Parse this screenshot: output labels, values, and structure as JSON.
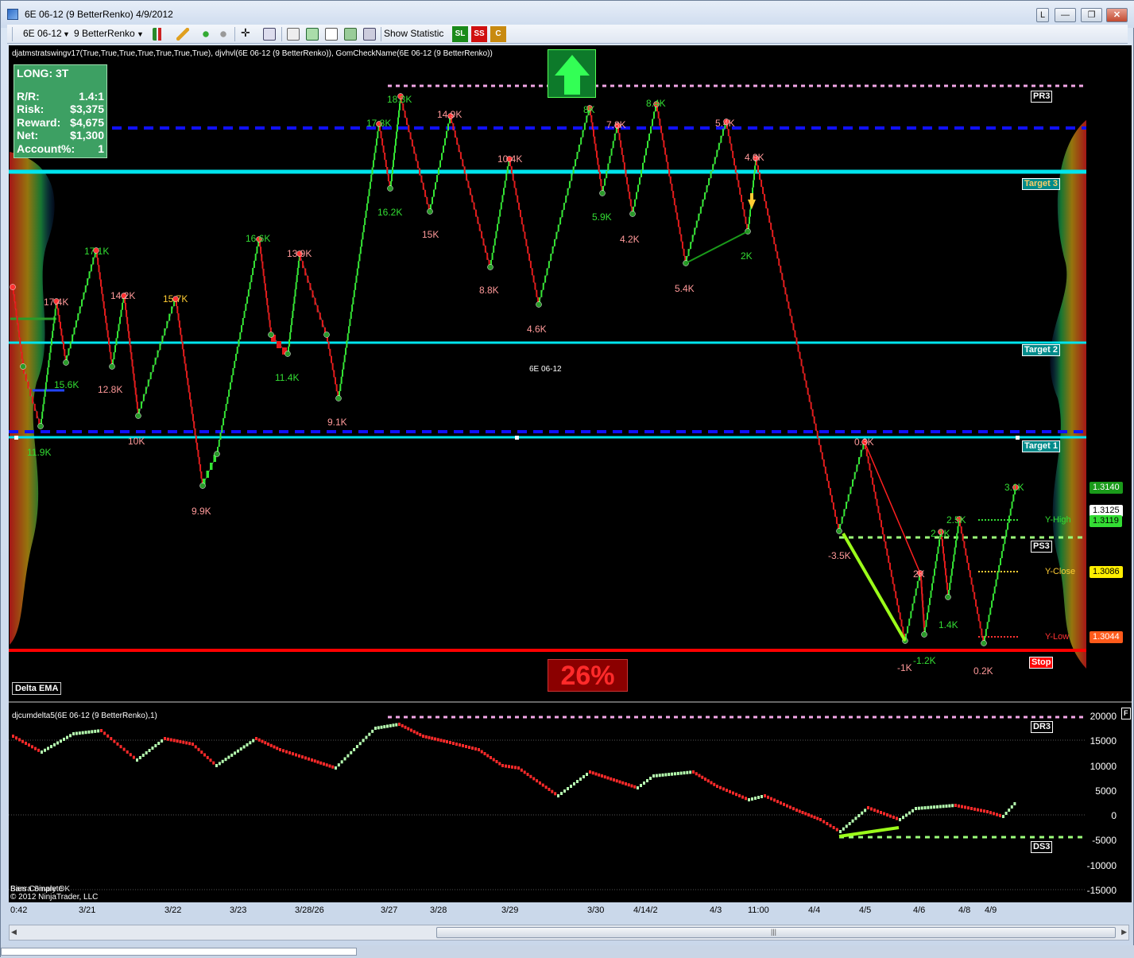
{
  "window": {
    "title": "6E 06-12 (9 BetterRenko)  4/9/2012",
    "controls": [
      "L",
      "—",
      "❐",
      "✕"
    ]
  },
  "toolbar": {
    "instrument": "6E 06-12",
    "period": "9 BetterRenko",
    "show_statistic": "Show Statistic",
    "sl": "SL",
    "ss": "SS",
    "c": "C"
  },
  "indicators": {
    "main": "djatmstratswingv17(True,True,True,True,True,True,True), djvhvl(6E 06-12 (9 BetterRenko)), GomCheckName(6E 06-12 (9 BetterRenko))",
    "lower": "djcumdelta5(6E 06-12 (9 BetterRenko),1)",
    "lower_flag": "F"
  },
  "info_box": {
    "title": "LONG: 3T",
    "rows": [
      {
        "label": "R/R:",
        "value": "1.4:1"
      },
      {
        "label": "Risk:",
        "value": "$3,375"
      },
      {
        "label": "Reward:",
        "value": "$4,675"
      },
      {
        "label": "Net:",
        "value": "$1,300"
      },
      {
        "label": "Account%:",
        "value": "1"
      }
    ]
  },
  "chart_center_label": "6E 06-12",
  "percent_box": "26%",
  "delta_ema": "Delta EMA",
  "tags": {
    "pr3": "PR3",
    "target3": "Target 3",
    "target2": "Target 2",
    "target1": "Target 1",
    "ps3": "PS3",
    "stop": "Stop",
    "dr3": "DR3",
    "ds3": "DS3",
    "y_high": "Y-High",
    "y_close": "Y-Close",
    "y_low": "Y-Low"
  },
  "price_labels": {
    "p1": "1.3140",
    "p2": "1.3125",
    "p3": "1.3119",
    "p4": "1.3086",
    "p5": "1.3044"
  },
  "lower_axis": [
    "20000",
    "15000",
    "10000",
    "5000",
    "0",
    "-5000",
    "-10000",
    "-15000"
  ],
  "swing_labels": [
    {
      "t": "17.4K",
      "c": "#ff9999"
    },
    {
      "t": "15.6K",
      "c": "#33dd33"
    },
    {
      "t": "11.9K",
      "c": "#33dd33"
    },
    {
      "t": "17.1K",
      "c": "#33dd33"
    },
    {
      "t": "14.2K",
      "c": "#ff9999"
    },
    {
      "t": "12.8K",
      "c": "#ff9999"
    },
    {
      "t": "15.7K",
      "c": "#ffcc33"
    },
    {
      "t": "10K",
      "c": "#ff9999"
    },
    {
      "t": "9.9K",
      "c": "#ff9999"
    },
    {
      "t": "16.6K",
      "c": "#33dd33"
    },
    {
      "t": "13.9K",
      "c": "#ff9999"
    },
    {
      "t": "11.4K",
      "c": "#33dd33"
    },
    {
      "t": "9.1K",
      "c": "#ff9999"
    },
    {
      "t": "17.8K",
      "c": "#33dd33"
    },
    {
      "t": "18.3K",
      "c": "#33dd33"
    },
    {
      "t": "16.2K",
      "c": "#33dd33"
    },
    {
      "t": "14.9K",
      "c": "#ff9999"
    },
    {
      "t": "15K",
      "c": "#ff9999"
    },
    {
      "t": "10.4K",
      "c": "#ff9999"
    },
    {
      "t": "8.8K",
      "c": "#ff9999"
    },
    {
      "t": "4.6K",
      "c": "#ff9999"
    },
    {
      "t": "8K",
      "c": "#33dd33"
    },
    {
      "t": "7.8K",
      "c": "#ff9999"
    },
    {
      "t": "5.9K",
      "c": "#33dd33"
    },
    {
      "t": "8.4K",
      "c": "#33dd33"
    },
    {
      "t": "4.2K",
      "c": "#ff9999"
    },
    {
      "t": "5.4K",
      "c": "#ff9999"
    },
    {
      "t": "5.4K",
      "c": "#ff9999"
    },
    {
      "t": "4.9K",
      "c": "#ff9999"
    },
    {
      "t": "2K",
      "c": "#33dd33"
    },
    {
      "t": "0.3K",
      "c": "#ff9999"
    },
    {
      "t": "-3.5K",
      "c": "#ff9999"
    },
    {
      "t": "3.1K",
      "c": "#33dd33"
    },
    {
      "t": "2.5K",
      "c": "#33dd33"
    },
    {
      "t": "2.1K",
      "c": "#33dd33"
    },
    {
      "t": "2K",
      "c": "#ff9999"
    },
    {
      "t": "1.4K",
      "c": "#33dd33"
    },
    {
      "t": "-1K",
      "c": "#ff9999"
    },
    {
      "t": "-1.2K",
      "c": "#33dd33"
    },
    {
      "t": "0.2K",
      "c": "#ff9999"
    }
  ],
  "dates": [
    "0:42",
    "3/21",
    "3/22",
    "3/23",
    "3/28/26",
    "3/27",
    "3/28",
    "3/29",
    "3/30",
    "4/14/2",
    "4/3",
    "11:00",
    "4/4",
    "4/5",
    "4/6",
    "4/8",
    "4/9"
  ],
  "copyright": [
    "Bars Complete",
    "Sierra Sinary OK",
    "© 2012 NinjaTrader, LLC"
  ],
  "colors": {
    "up": "#33e633",
    "down": "#e61a1a",
    "target": "#00e5ee",
    "pivot": "#1010ff",
    "stop": "#ff0000",
    "pr": "#f2a6e6",
    "ps": "#9cff7a"
  }
}
